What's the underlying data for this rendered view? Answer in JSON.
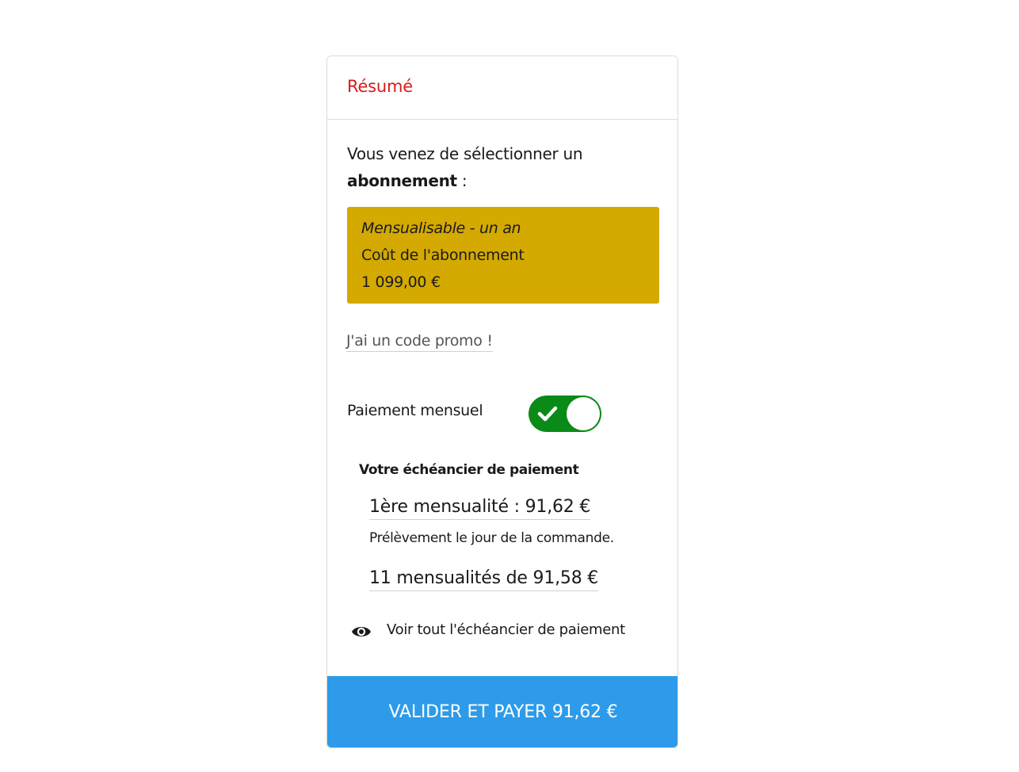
{
  "summary": {
    "title": "Résumé"
  },
  "intro": {
    "text": "Vous venez de sélectionner un",
    "bold": "abonnement",
    "suffix": " :"
  },
  "plan": {
    "name": "Mensualisable - un an",
    "cost_label": "Coût de l'abonnement",
    "cost_value": "1 099,00 €",
    "background_color": "#d4a900"
  },
  "promo": {
    "label": "J'ai un code promo !"
  },
  "monthly_payment": {
    "label": "Paiement mensuel",
    "enabled": true,
    "toggle_color": "#0a8a16"
  },
  "schedule": {
    "title": "Votre échéancier de paiement",
    "first_installment": "1ère mensualité : 91,62 €",
    "first_installment_note": "Prélèvement le jour de la commande.",
    "remaining_installments": "11 mensualités de 91,58 €",
    "view_all_label": "Voir tout l'échéancier de paiement",
    "view_all_icon": "eye-icon"
  },
  "actions": {
    "pay_label": "VALIDER ET PAYER 91,62 €",
    "pay_color": "#2d9be9"
  },
  "colors": {
    "title_red": "#d71a1a"
  }
}
